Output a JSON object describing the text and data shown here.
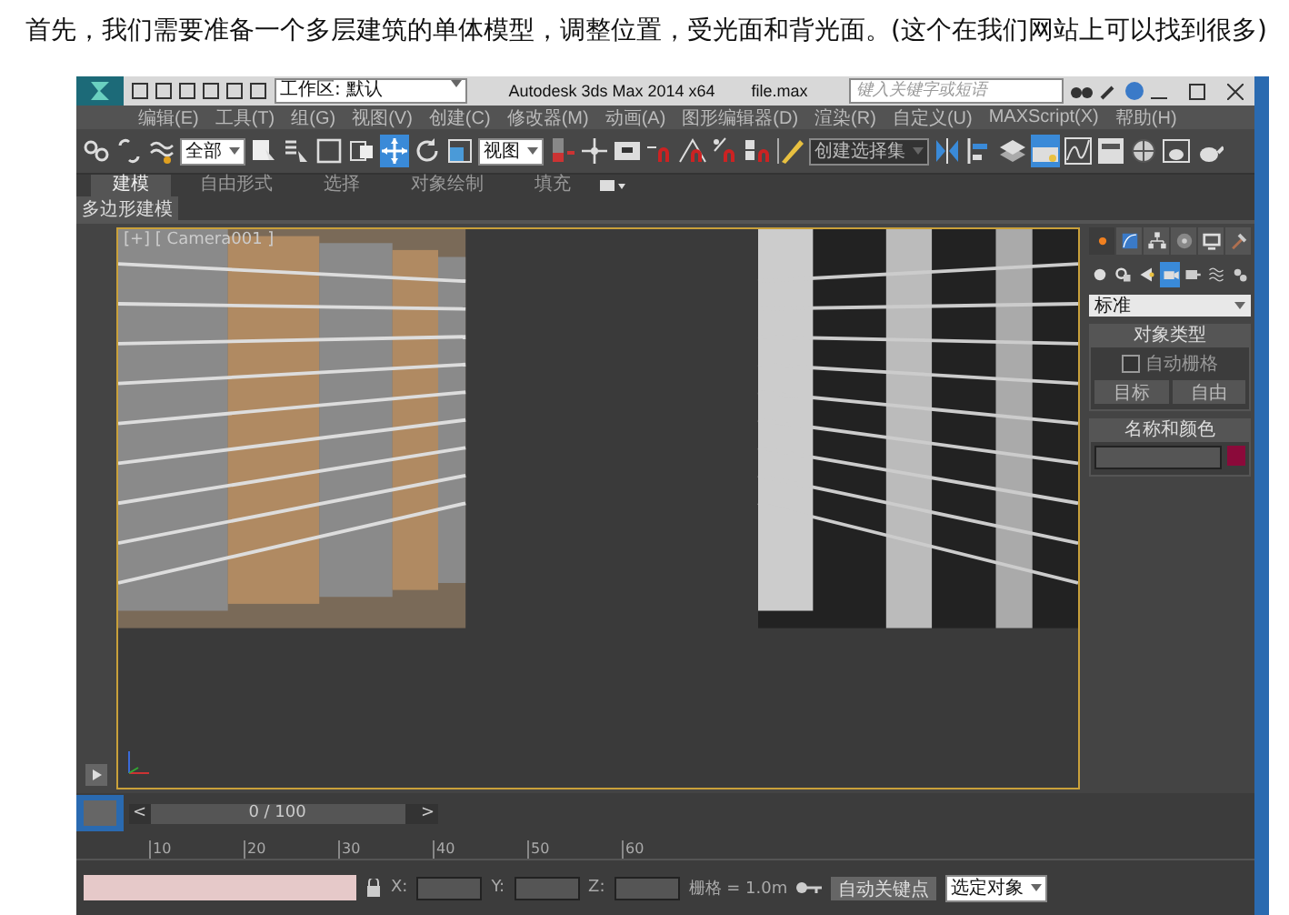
{
  "caption": "首先，我们需要准备一个多层建筑的单体模型，调整位置，受光面和背光面。(这个在我们网站上可以找到很多)",
  "window": {
    "title": "Autodesk 3ds Max  2014 x64",
    "file": "file.max",
    "workspace": "工作区: 默认",
    "search": {
      "placeholder": "键入关键字或短语"
    }
  },
  "menu": [
    "编辑(E)",
    "工具(T)",
    "组(G)",
    "视图(V)",
    "创建(C)",
    "修改器(M)",
    "动画(A)",
    "图形编辑器(D)",
    "渲染(R)",
    "自定义(U)",
    "MAXScript(X)",
    "帮助(H)"
  ],
  "toolbar": [
    {
      "kind": "link",
      "selected": false
    },
    {
      "kind": "unlink",
      "selected": false
    },
    {
      "kind": "bind",
      "selected": false
    },
    {
      "kind": "dropdown",
      "value": "全部"
    },
    {
      "kind": "select",
      "selected": false
    },
    {
      "kind": "selname",
      "selected": false
    },
    {
      "kind": "rect",
      "selected": false
    },
    {
      "kind": "window",
      "selected": false
    },
    {
      "kind": "move",
      "selected": true
    },
    {
      "kind": "rotate",
      "selected": false
    },
    {
      "kind": "scale",
      "selected": false
    },
    {
      "kind": "dropdown",
      "value": "视图"
    },
    {
      "kind": "pivot",
      "selected": false
    },
    {
      "kind": "manip",
      "selected": false
    },
    {
      "kind": "key",
      "selected": false
    },
    {
      "kind": "snap",
      "selected": false
    },
    {
      "kind": "angle",
      "selected": false
    },
    {
      "kind": "percent",
      "selected": false
    },
    {
      "kind": "spinner",
      "selected": false
    },
    {
      "kind": "namedsel",
      "selected": false
    },
    {
      "kind": "dropdown",
      "value": "创建选择集"
    },
    {
      "kind": "mirror",
      "selected": false
    },
    {
      "kind": "align",
      "selected": false
    },
    {
      "kind": "layer",
      "selected": false
    },
    {
      "kind": "explorer",
      "selected": true
    },
    {
      "kind": "curve",
      "selected": false
    },
    {
      "kind": "schematic",
      "selected": false
    },
    {
      "kind": "material",
      "selected": false
    },
    {
      "kind": "rendersetup",
      "selected": false
    },
    {
      "kind": "render",
      "selected": false
    }
  ],
  "ribbon": {
    "tabs": [
      {
        "label": "建模",
        "selected": true
      },
      {
        "label": "自由形式",
        "selected": false
      },
      {
        "label": "选择",
        "selected": false
      },
      {
        "label": "对象绘制",
        "selected": false
      },
      {
        "label": "填充",
        "selected": false
      }
    ],
    "panel": "多边形建模"
  },
  "viewport": {
    "label": "[+] [ Camera001 ]"
  },
  "command_panel": {
    "tabs": [
      {
        "kind": "create",
        "selected": true
      },
      {
        "kind": "modify",
        "selected": false
      },
      {
        "kind": "hierarchy",
        "selected": false
      },
      {
        "kind": "motion",
        "selected": false
      },
      {
        "kind": "display",
        "selected": false
      },
      {
        "kind": "utilities",
        "selected": false
      }
    ],
    "categories": [
      {
        "kind": "geometry",
        "selected": false
      },
      {
        "kind": "shapes",
        "selected": false
      },
      {
        "kind": "lights",
        "selected": false
      },
      {
        "kind": "cameras",
        "selected": true
      },
      {
        "kind": "helpers",
        "selected": false
      },
      {
        "kind": "spacewarps",
        "selected": false
      },
      {
        "kind": "systems",
        "selected": false
      }
    ],
    "type_dropdown": "标准",
    "object_type": {
      "title": "对象类型",
      "autogrid": {
        "label": "自动栅格",
        "checked": false
      },
      "buttons": [
        "目标",
        "自由"
      ]
    },
    "name_color": {
      "title": "名称和颜色",
      "color": "#8b0a3a"
    }
  },
  "timeline": {
    "frame": "0 / 100",
    "prev": "<",
    "next": ">",
    "level": 0,
    "ticks": [
      "10",
      "20",
      "30",
      "40",
      "50",
      "60"
    ]
  },
  "status_bar": {
    "coords": [
      "X:",
      "Y:",
      "Z:"
    ],
    "grid": "栅格 = 1.0m",
    "autokey": "自动关键点",
    "key_filter": "选定对象"
  }
}
